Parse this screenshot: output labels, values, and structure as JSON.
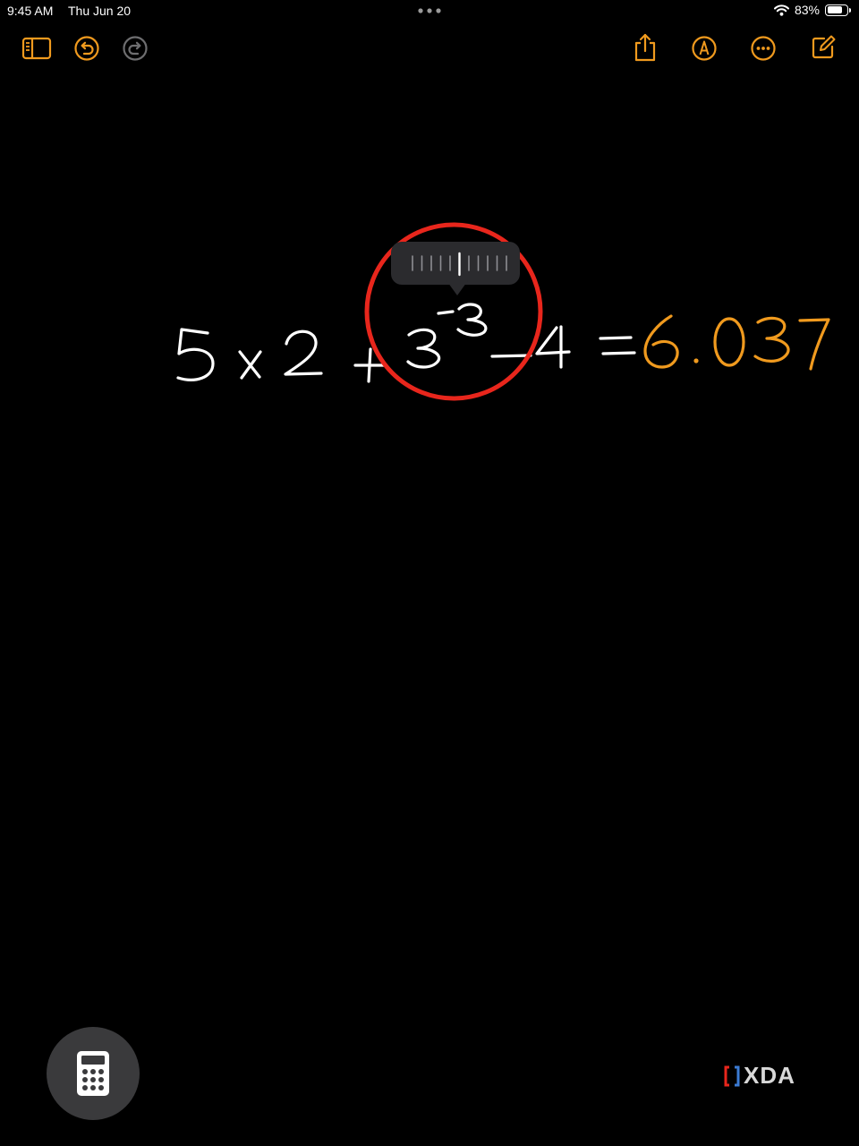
{
  "status_bar": {
    "time": "9:45 AM",
    "date": "Thu Jun 20",
    "battery_percent": "83%",
    "battery_level": 0.83
  },
  "toolbar": {
    "icons": {
      "sidebar": "sidebar-icon",
      "undo": "undo-icon",
      "redo": "redo-icon",
      "share": "share-icon",
      "markup": "markup-pen-icon",
      "more": "more-icon",
      "compose": "compose-icon"
    },
    "accent_color": "#f09a1e",
    "disabled_color": "#6e6e70"
  },
  "expression": {
    "base_terms": "5x2+3",
    "exponent": "-3",
    "tail": "-4 =",
    "result": "6.037",
    "ink_color": "#ffffff",
    "result_color": "#f09a1e"
  },
  "slider_popup": {
    "tick_count": 11,
    "selected_tick": 5
  },
  "highlight": {
    "color": "#e8261c"
  },
  "floating_button": {
    "icon": "calculator-icon"
  },
  "watermark": {
    "text": "XDA"
  }
}
